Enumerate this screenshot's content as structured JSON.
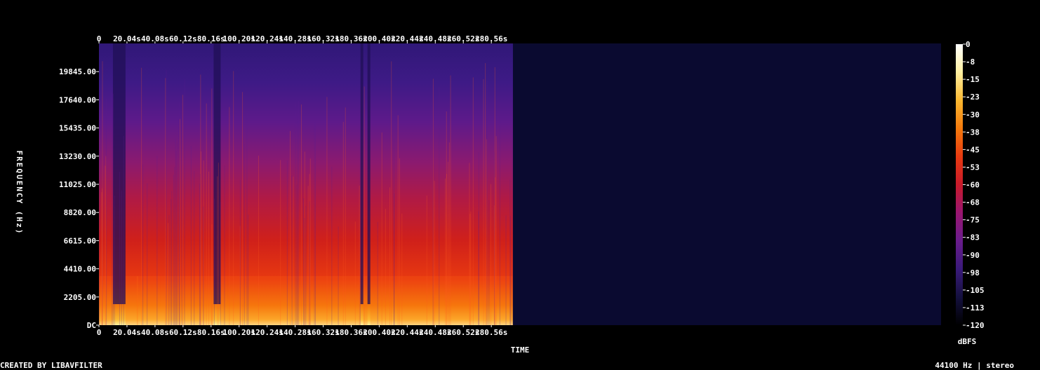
{
  "chart_data": {
    "type": "heatmap",
    "title": "",
    "xlabel": "TIME",
    "ylabel": "FREQUENCY (Hz)",
    "x_ticks": [
      "0",
      "20.04s",
      "40.08s",
      "60.12s",
      "80.16s",
      "100.20s",
      "120.24s",
      "140.28s",
      "160.32s",
      "180.36s",
      "200.40s",
      "220.44s",
      "240.48s",
      "260.52s",
      "280.56s"
    ],
    "x_tick_values": [
      0,
      20.04,
      40.08,
      60.12,
      80.16,
      100.2,
      120.24,
      140.28,
      160.32,
      180.36,
      200.4,
      220.44,
      240.48,
      260.52,
      280.56
    ],
    "xlim": [
      0,
      296
    ],
    "y_ticks": [
      "DC",
      "2205.00",
      "4410.00",
      "6615.00",
      "8820.00",
      "11025.00",
      "13230.00",
      "15435.00",
      "17640.00",
      "19845.00"
    ],
    "y_tick_values": [
      0,
      2205,
      4410,
      6615,
      8820,
      11025,
      13230,
      15435,
      17640,
      19845
    ],
    "ylim": [
      0,
      22050
    ],
    "colorbar": {
      "label": "dBFS",
      "ticks": [
        "0",
        "-8",
        "-15",
        "-23",
        "-30",
        "-38",
        "-45",
        "-53",
        "-60",
        "-68",
        "-75",
        "-83",
        "-90",
        "-98",
        "-105",
        "-113",
        "-120"
      ],
      "range": [
        -120,
        0
      ]
    },
    "colormap": [
      "#000000",
      "#14103e",
      "#3a1a7a",
      "#6a1c8c",
      "#9a1670",
      "#c81a2a",
      "#e83a10",
      "#f47a0c",
      "#fbb830",
      "#fff0a0",
      "#ffffff"
    ],
    "loud_segments_s": [
      [
        0,
        10
      ],
      [
        19,
        28
      ],
      [
        27,
        44
      ],
      [
        44,
        82
      ],
      [
        87,
        92
      ],
      [
        92,
        187
      ],
      [
        189,
        192
      ],
      [
        194,
        205
      ],
      [
        205,
        296
      ]
    ],
    "quiet_segments_s": [
      [
        10,
        19
      ],
      [
        82,
        87
      ],
      [
        187,
        189
      ],
      [
        192,
        194
      ]
    ],
    "end_time_s": 296
  },
  "footer": {
    "left": "CREATED BY LIBAVFILTER",
    "right": "44100 Hz | stereo"
  }
}
